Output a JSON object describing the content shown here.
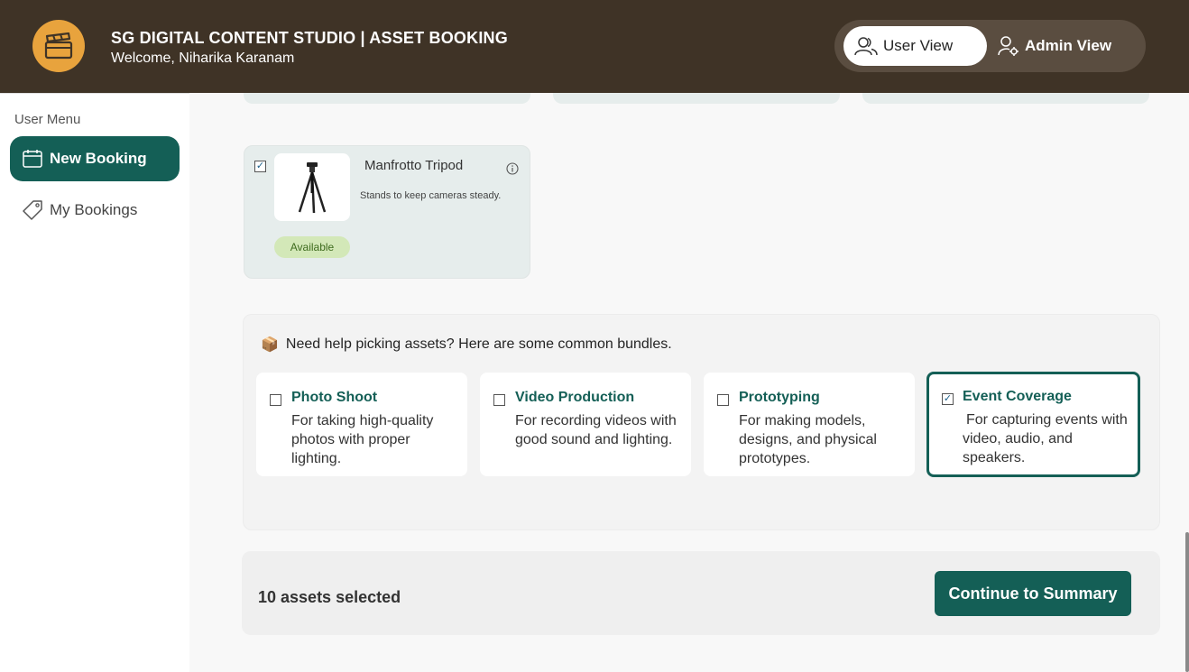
{
  "header": {
    "app_title": "SG DIGITAL CONTENT STUDIO | ASSET BOOKING",
    "welcome": "Welcome, Niharika Karanam",
    "logo_icon": "clapperboard-icon",
    "user_view_label": "User View",
    "admin_view_label": "Admin View",
    "active_view": "User View"
  },
  "sidebar": {
    "heading": "User Menu",
    "items": [
      {
        "label": "New Booking",
        "icon": "calendar-icon",
        "active": true
      },
      {
        "label": "My Bookings",
        "icon": "tag-icon",
        "active": false
      }
    ]
  },
  "asset": {
    "name": "Manfrotto Tripod",
    "description": "Stands to keep cameras steady.",
    "status": "Available",
    "checked": true,
    "image": "tripod"
  },
  "bundles": {
    "heading_icon": "📦",
    "heading": "Need help picking assets? Here are some common bundles.",
    "items": [
      {
        "title": "Photo Shoot",
        "description": "For taking high-quality photos with proper lighting.",
        "checked": false
      },
      {
        "title": "Video Production",
        "description": "For recording videos with good sound and lighting.",
        "checked": false
      },
      {
        "title": "Prototyping",
        "description": "For making models, designs, and physical prototypes.",
        "checked": false
      },
      {
        "title": "Event Coverage",
        "description": "For capturing events with video, audio, and speakers.",
        "checked": true
      }
    ]
  },
  "footer": {
    "selected_count": "10 assets selected",
    "continue_label": "Continue to Summary"
  },
  "colors": {
    "header_bg": "#3f3326",
    "accent": "#145f56",
    "logo_bg": "#e8a33d",
    "available_badge": "#d3e8b8"
  }
}
